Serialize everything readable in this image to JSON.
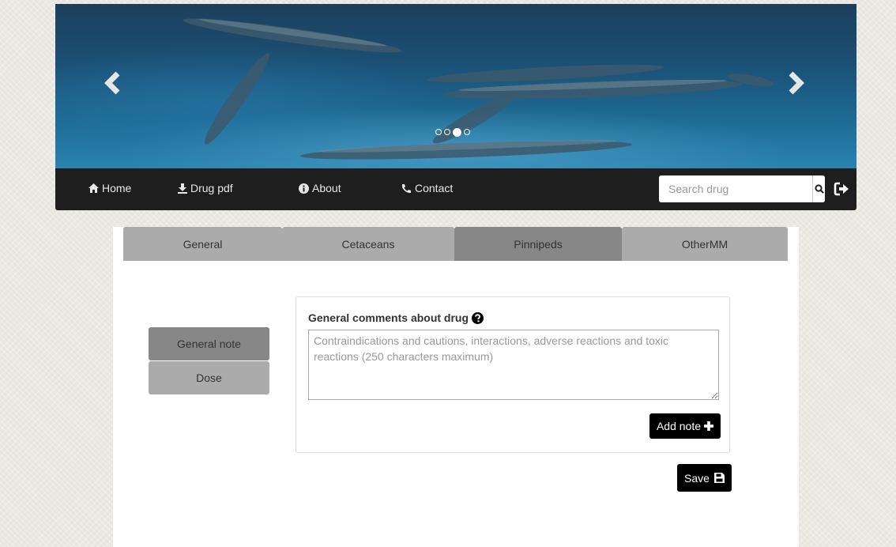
{
  "carousel": {
    "prev_label": "‹",
    "next_label": "›",
    "slide_count": 4,
    "active_slide": 3
  },
  "nav": {
    "home": "Home",
    "drug_pdf": "Drug pdf",
    "about": "About",
    "contact": "Contact",
    "search_placeholder": "Search drug"
  },
  "tabs": [
    {
      "label": "General",
      "active": false
    },
    {
      "label": "Cetaceans",
      "active": false
    },
    {
      "label": "Pinnipeds",
      "active": true
    },
    {
      "label": "OtherMM",
      "active": false
    }
  ],
  "sidebar": {
    "general_note": "General note",
    "dose": "Dose"
  },
  "note": {
    "label": "General comments about drug",
    "placeholder": "Contraindications and cautions, interactions, adverse reactions and toxic reactions (250 characters maximum)",
    "add_label": "Add note"
  },
  "save_label": "Save",
  "colors": {
    "navbar": "#1e1e1e",
    "tab_active": "#878787",
    "tab_inactive": "#ababab",
    "button": "#000000"
  },
  "icons": [
    "home-icon",
    "download-icon",
    "info-icon",
    "phone-icon",
    "search-icon",
    "logout-icon",
    "question-icon",
    "plus-icon",
    "save-icon",
    "chevron-left-icon",
    "chevron-right-icon"
  ]
}
